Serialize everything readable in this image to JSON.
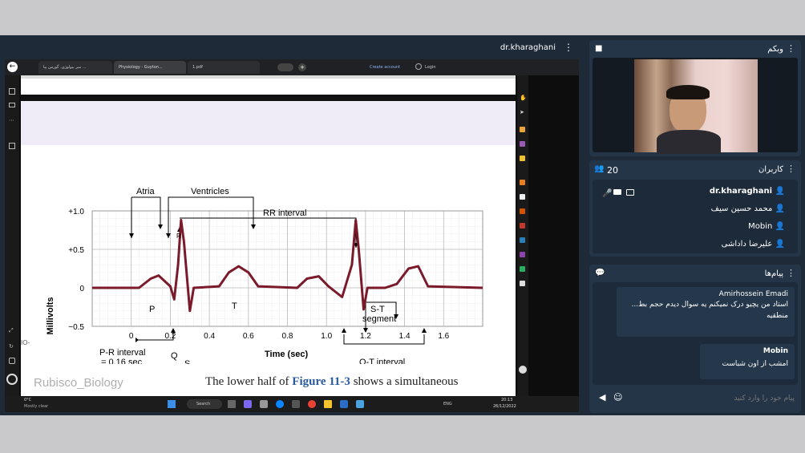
{
  "presenter": {
    "name": "dr.kharaghani"
  },
  "browser": {
    "tabs": [
      "مبر بیولوژی، گورس پیا ...",
      "Physiology - Guyton...",
      "1.pdf"
    ],
    "create_account": "Create account",
    "login": "Login"
  },
  "figure": {
    "labels": {
      "atria": "Atria",
      "ventricles": "Ventricles",
      "rr": "RR interval",
      "st": "S-T",
      "segment": "segment",
      "p": "P",
      "q": "Q",
      "r": "R",
      "s": "S",
      "t": "T",
      "pr1": "P-R interval",
      "pr2": "= 0.16 sec",
      "qt": "Q-T interval",
      "io": "IO-"
    },
    "caption_plain": "The lower half of ",
    "caption_link": "Figure 11-3",
    "caption_rest": " shows a simultaneous",
    "watermark": "Rubisco_Biology"
  },
  "chart_data": {
    "type": "line",
    "xlabel": "Time (sec)",
    "ylabel": "Millivolts",
    "x_ticks": [
      "0",
      "0.2",
      "0.4",
      "0.6",
      "0.8",
      "1.0",
      "1.2",
      "1.4",
      "1.6"
    ],
    "y_ticks": [
      "+1.0",
      "+0.5",
      "0",
      "−0.5"
    ],
    "xlim": [
      -0.2,
      1.8
    ],
    "ylim": [
      -0.5,
      1.0
    ],
    "series": [
      {
        "color": "#7a1a2a",
        "x": [
          -0.2,
          0.04,
          0.1,
          0.14,
          0.2,
          0.22,
          0.24,
          0.255,
          0.27,
          0.3,
          0.32,
          0.45,
          0.5,
          0.55,
          0.6,
          0.65,
          0.85,
          0.9,
          0.96,
          1.01,
          1.08,
          1.13,
          1.15,
          1.165,
          1.19,
          1.21,
          1.3,
          1.36,
          1.42,
          1.47,
          1.52,
          1.8
        ],
        "y": [
          0,
          0,
          0.12,
          0.16,
          0.02,
          -0.15,
          0.3,
          0.88,
          0.6,
          -0.3,
          0,
          0.02,
          0.2,
          0.28,
          0.2,
          0.02,
          0,
          0.12,
          0.15,
          0.02,
          -0.12,
          0.3,
          0.88,
          0.5,
          -0.28,
          0,
          0,
          0.05,
          0.25,
          0.28,
          0.02,
          0
        ]
      }
    ]
  },
  "taskbar": {
    "weather_temp": "0°C",
    "weather_desc": "Mostly clear",
    "search": "Search",
    "lang": "ENG",
    "time": "20:13",
    "date": "26/12/2022"
  },
  "webcam_panel": {
    "title": "وبکم"
  },
  "users_panel": {
    "title": "کاربران",
    "count": "20",
    "users": [
      {
        "name": "dr.kharaghani",
        "color": "#4a90e2"
      },
      {
        "name": "محمد حسین سیف",
        "color": "#f5c542"
      },
      {
        "name": "Mobin",
        "color": "#f5c542"
      },
      {
        "name": "علیرضا داداشی",
        "color": "#f5c542"
      }
    ]
  },
  "messages_panel": {
    "title": "پیام‌ها",
    "messages": [
      {
        "author": "Amirhossein Emadi",
        "lines": [
          "استاد من یچیو درک نمیکنم یه سوال دیدم حجم بط...",
          "منطقیه"
        ]
      },
      {
        "author": "Mobin",
        "lines": [
          "امشب از اون شباست"
        ]
      }
    ],
    "input_placeholder": "پیام خود را وارد کنید"
  }
}
